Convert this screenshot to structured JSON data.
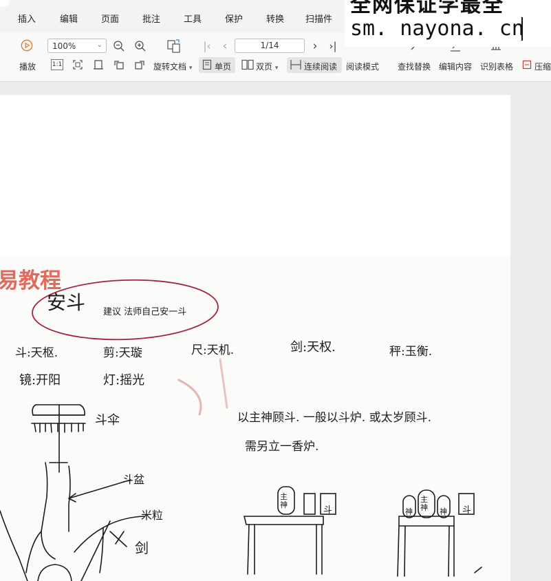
{
  "menu": [
    "插入",
    "编辑",
    "页面",
    "批注",
    "工具",
    "保护",
    "转换",
    "扫描件"
  ],
  "toolbar": {
    "play": "播放",
    "zoom": "100%",
    "rotate": "旋转文档",
    "single_page": "单页",
    "double_page": "双页",
    "continuous": "连续阅读",
    "read_mode": "阅读模式",
    "find_replace": "查找替换",
    "edit_content": "编辑内容",
    "recognize_table": "识别表格",
    "compress": "压缩",
    "page_indicator": "1/14",
    "actual_size": "1:1"
  },
  "watermark": {
    "line1": "全网保证学最全",
    "url": "sm. nayona. cn"
  },
  "document": {
    "title": "易教程",
    "note_heading": "安斗",
    "note_sub": "建议 法师自己安一斗",
    "line1": [
      "斗:天枢.",
      "剪:天璇",
      "尺:天机.",
      "剑:天权.",
      "秤:玉衡."
    ],
    "line2": [
      "镜:开阳",
      "灯:摇光"
    ],
    "label_lid": "斗伞",
    "label_body": "斗盆",
    "label_rice": "米粒",
    "label_sword": "剑",
    "text_right1": "以主神顾斗. 一般以斗炉. 或太岁顾斗.",
    "text_right2": "需另立一香炉.",
    "tablet_main": "主神",
    "tablet_dou": "斗",
    "tablet_small": "神"
  }
}
